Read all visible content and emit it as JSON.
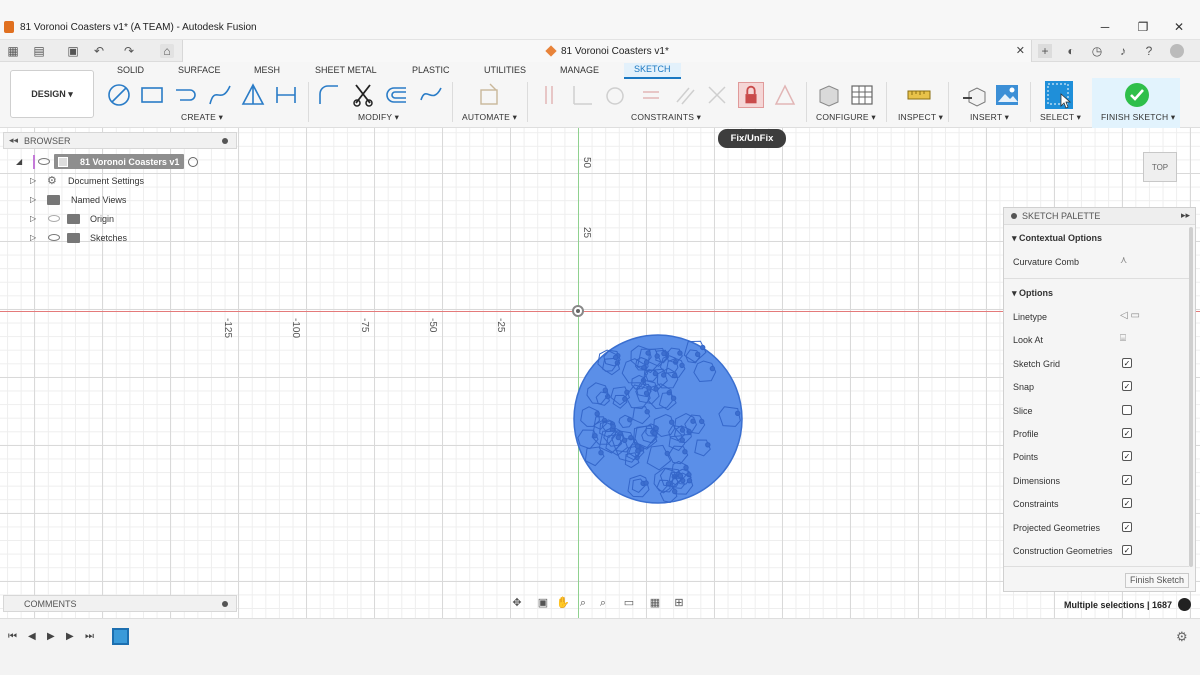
{
  "window": {
    "title": "81 Voronoi Coasters v1* (A TEAM) - Autodesk Fusion",
    "minimize": "─",
    "maximize": "❐",
    "close": "✕"
  },
  "doc_tab": {
    "title": "81 Voronoi Coasters v1*",
    "close": "✕"
  },
  "ribbon": {
    "workspace": "DESIGN ▾",
    "tabs": [
      "SOLID",
      "SURFACE",
      "MESH",
      "SHEET METAL",
      "PLASTIC",
      "UTILITIES",
      "MANAGE",
      "SKETCH"
    ],
    "active_tab": "SKETCH",
    "groups": {
      "create": "CREATE ▾",
      "modify": "MODIFY ▾",
      "automate": "AUTOMATE ▾",
      "constraints": "CONSTRAINTS ▾",
      "configure": "CONFIGURE ▾",
      "inspect": "INSPECT ▾",
      "insert": "INSERT ▾",
      "select": "SELECT ▾",
      "finish": "FINISH SKETCH ▾"
    }
  },
  "tooltip": "Fix/UnFix",
  "browser": {
    "title": "BROWSER",
    "root": "81 Voronoi Coasters v1",
    "items": [
      "Document Settings",
      "Named Views",
      "Origin",
      "Sketches"
    ]
  },
  "comments": {
    "title": "COMMENTS"
  },
  "axis_ticks": {
    "horizontal": [
      "-125",
      "-100",
      "-75",
      "-50",
      "-25"
    ],
    "vertical": [
      "50",
      "25"
    ]
  },
  "viewcube": {
    "face": "TOP"
  },
  "palette": {
    "title": "SKETCH PALETTE",
    "sections": {
      "contextual": "Contextual Options",
      "options": "Options"
    },
    "contextual_items": [
      {
        "label": "Curvature Comb"
      }
    ],
    "options": [
      {
        "label": "Linetype",
        "kind": "icon"
      },
      {
        "label": "Look At",
        "kind": "icon"
      },
      {
        "label": "Sketch Grid",
        "checked": true
      },
      {
        "label": "Snap",
        "checked": true
      },
      {
        "label": "Slice",
        "checked": false
      },
      {
        "label": "Profile",
        "checked": true
      },
      {
        "label": "Points",
        "checked": true
      },
      {
        "label": "Dimensions",
        "checked": true
      },
      {
        "label": "Constraints",
        "checked": true
      },
      {
        "label": "Projected Geometries",
        "checked": true
      },
      {
        "label": "Construction Geometries",
        "checked": true
      }
    ],
    "finish_button": "Finish Sketch"
  },
  "status": {
    "text": "Multiple selections | 1687"
  },
  "colors": {
    "accent": "#1a78c2",
    "sketch_fill": "#5b8fe8",
    "finish_check": "#2fbf4a",
    "x_axis": "#e47a7a",
    "y_axis": "#8fd18f"
  }
}
